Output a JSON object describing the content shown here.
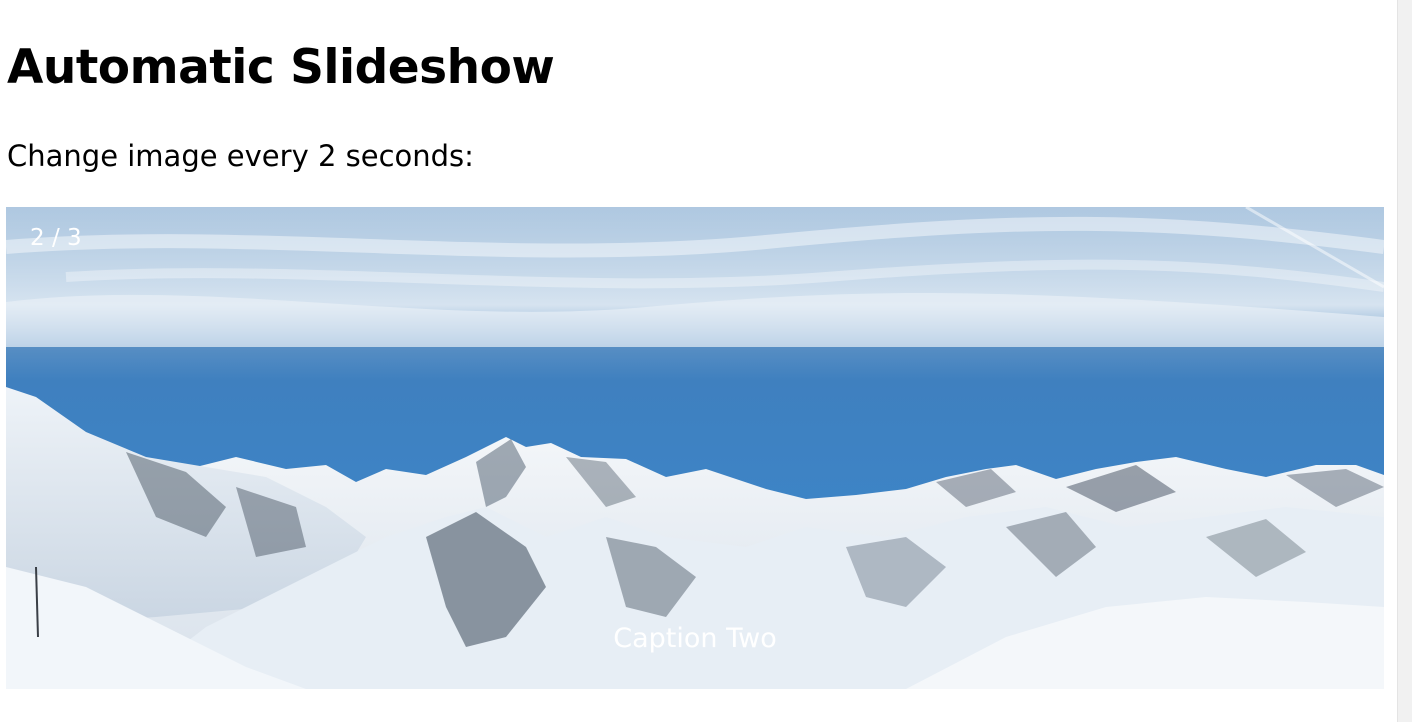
{
  "heading": "Automatic Slideshow",
  "subtitle": "Change image every 2 seconds:",
  "slideshow": {
    "current": 2,
    "total": 3,
    "counter": "2 / 3",
    "caption": "Caption Two",
    "image_subject": "snowy-mountains-landscape"
  },
  "colors": {
    "sky_top": "#5a8fc3",
    "sky_mid": "#3d7fbe",
    "snow": "#eef2f6",
    "rock": "#4a5666",
    "overlay_text": "#ffffff"
  }
}
